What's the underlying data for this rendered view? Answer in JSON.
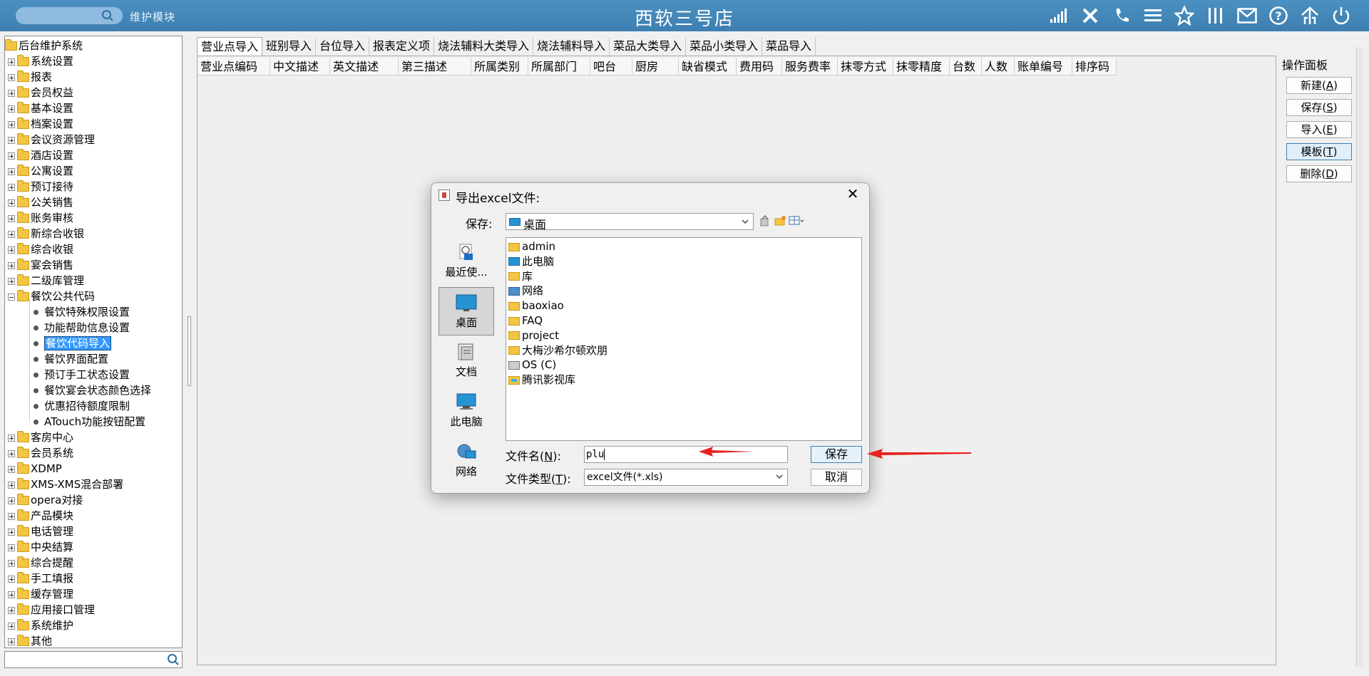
{
  "header": {
    "module_label": "维护模块",
    "app_title": "西软三号店"
  },
  "tree": {
    "root": "后台维护系统",
    "items_before": [
      "系统设置",
      "报表",
      "会员权益",
      "基本设置",
      "档案设置",
      "会议资源管理",
      "酒店设置",
      "公寓设置",
      "预订接待",
      "公关销售",
      "账务审核",
      "新综合收银",
      "综合收银",
      "宴会销售",
      "二级库管理"
    ],
    "expanded": "餐饮公共代码",
    "children": [
      "餐饮特殊权限设置",
      "功能帮助信息设置",
      "餐饮代码导入",
      "餐饮界面配置",
      "预订手工状态设置",
      "餐饮宴会状态颜色选择",
      "优惠招待额度限制",
      "ATouch功能按钮配置"
    ],
    "selected_child": "餐饮代码导入",
    "items_after": [
      "客房中心",
      "会员系统",
      "XDMP",
      "XMS-XMS混合部署",
      "opera对接",
      "产品模块",
      "电话管理",
      "中央结算",
      "综合提醒",
      "手工填报",
      "缓存管理",
      "应用接口管理",
      "系统维护",
      "其他"
    ]
  },
  "tabs": [
    "营业点导入",
    "班别导入",
    "台位导入",
    "报表定义项",
    "烧法辅料大类导入",
    "烧法辅料导入",
    "菜品大类导入",
    "菜品小类导入",
    "菜品导入"
  ],
  "active_tab": "营业点导入",
  "columns": [
    "营业点编码",
    "中文描述",
    "英文描述",
    "第三描述",
    "所属类别",
    "所属部门",
    "吧台",
    "厨房",
    "缺省模式",
    "费用码",
    "服务费率",
    "抹零方式",
    "抹零精度",
    "台数",
    "人数",
    "账单编号",
    "排序码"
  ],
  "op_panel": {
    "title": "操作面板",
    "buttons": [
      {
        "label": "新建",
        "key": "A"
      },
      {
        "label": "保存",
        "key": "S"
      },
      {
        "label": "导入",
        "key": "E"
      },
      {
        "label": "模板",
        "key": "T"
      },
      {
        "label": "删除",
        "key": "D"
      }
    ]
  },
  "dialog": {
    "title": "导出excel文件:",
    "save_in_label": "保存:",
    "save_in_value": "桌面",
    "places": [
      "最近使...",
      "桌面",
      "文档",
      "此电脑",
      "网络"
    ],
    "selected_place": "桌面",
    "files": [
      {
        "name": "admin",
        "icon": "folder-icon"
      },
      {
        "name": "此电脑",
        "icon": "computer-icon"
      },
      {
        "name": "库",
        "icon": "folder-icon"
      },
      {
        "name": "网络",
        "icon": "network-icon"
      },
      {
        "name": "baoxiao",
        "icon": "folder-icon"
      },
      {
        "name": "FAQ",
        "icon": "folder-icon"
      },
      {
        "name": "project",
        "icon": "folder-icon"
      },
      {
        "name": "大梅沙希尔顿欢朋",
        "icon": "folder-icon"
      },
      {
        "name": "OS (C)",
        "icon": "drive-icon"
      },
      {
        "name": "腾讯影视库",
        "icon": "video-folder-icon"
      }
    ],
    "filename_label": "文件名",
    "filename_key": "N",
    "filename_value": "plu",
    "filetype_label": "文件类型",
    "filetype_key": "T",
    "filetype_value": "excel文件(*.xls)",
    "save_button": "保存",
    "cancel_button": "取消"
  },
  "colors": {
    "header": "#3d7fb1",
    "selection": "#3399ff",
    "annotation_arrow": "#e8231e"
  }
}
